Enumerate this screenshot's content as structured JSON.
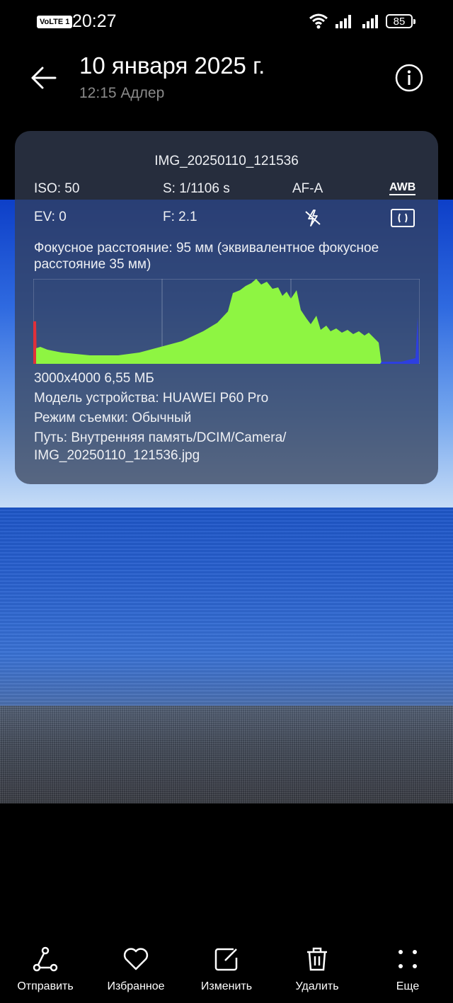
{
  "status_bar": {
    "volte": "VoLTE 1",
    "time": "20:27",
    "battery": "85"
  },
  "header": {
    "title": "10 января 2025 г.",
    "subtitle": "12:15 Адлер"
  },
  "details": {
    "filename": "IMG_20250110_121536",
    "iso": "ISO: 50",
    "shutter": "S: 1/1106 s",
    "af": "AF-A",
    "awb": "AWB",
    "ev": "EV: 0",
    "aperture": "F: 2.1",
    "focal": "Фокусное расстояние: 95 мм (эквивалентное фокусное расстояние 35 мм)",
    "resolution_size": "3000x4000  6,55 МБ",
    "device": "Модель устройства:  HUAWEI P60 Pro",
    "mode": "Режим съемки:  Обычный",
    "path_line1": "Путь:  Внутренняя память/DCIM/Camera/",
    "path_line2": "IMG_20250110_121536.jpg"
  },
  "toolbar": {
    "send": "Отправить",
    "favorite": "Избранное",
    "edit": "Изменить",
    "delete": "Удалить",
    "more": "Еще"
  },
  "colors": {
    "histogram_green": "#8ef542",
    "panel": "#343e54",
    "sky": "#2f6ae0",
    "sea": "#2a62cf"
  }
}
